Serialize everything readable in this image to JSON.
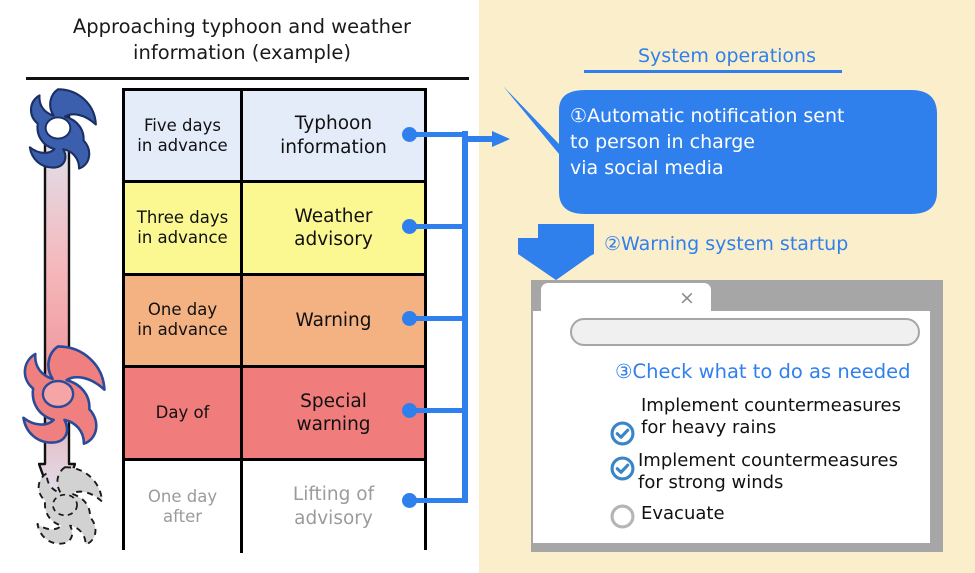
{
  "left_panel": {
    "title": "Approaching typhoon and weather information (example)",
    "title_line1": "Approaching typhoon and weather",
    "title_line2": "information (example)",
    "table": {
      "rows": [
        {
          "timing": "Five days in advance",
          "timing_l1": "Five days",
          "timing_l2": "in advance",
          "info": "Typhoon information",
          "info_l1": "Typhoon",
          "info_l2": "information",
          "color": "#e4ecfa",
          "state": "active"
        },
        {
          "timing": "Three days in advance",
          "timing_l1": "Three days",
          "timing_l2": "in advance",
          "info": "Weather advisory",
          "info_l1": "Weather",
          "info_l2": "advisory",
          "color": "#fbf791",
          "state": "active"
        },
        {
          "timing": "One day in advance",
          "timing_l1": "One day",
          "timing_l2": "in advance",
          "info": "Warning",
          "info_l1": "Warning",
          "info_l2": "",
          "color": "#f4b181",
          "state": "active"
        },
        {
          "timing": "Day of",
          "timing_l1": "Day of",
          "timing_l2": "",
          "info": "Special warning",
          "info_l1": "Special",
          "info_l2": "warning",
          "color": "#f07c7c",
          "state": "active"
        },
        {
          "timing": "One day after",
          "timing_l1": "One day",
          "timing_l2": "after",
          "info": "Lifting of advisory",
          "info_l1": "Lifting of",
          "info_l2": "advisory",
          "color": "#ffffff",
          "state": "dimmed"
        }
      ]
    },
    "timeline": {
      "approaching_cyclone_color": "#3b5fad",
      "peak_cyclone_color": "#f08080",
      "dissipating_cyclone_color": "#d0d0d0"
    }
  },
  "right_panel": {
    "heading": "System operations",
    "accent_color": "#2f80ed",
    "background_color": "#fbeecb",
    "step1": {
      "text": "①Automatic notification sent to person in charge via social media",
      "line1": "①Automatic notification sent",
      "line2": "to person in charge",
      "line3": "via social media"
    },
    "step2": {
      "label": "②Warning system startup"
    },
    "step3": {
      "heading": "③Check what to do as needed",
      "search_value": "",
      "close_label": "×",
      "checklist": [
        {
          "label": "Implement countermeasures for heavy rains",
          "line1": "Implement countermeasures",
          "line2": " for heavy rains",
          "checked": true
        },
        {
          "label": "Implement countermeasures for strong winds",
          "line1": "Implement countermeasures",
          "line2": " for strong winds",
          "checked": true
        },
        {
          "label": "Evacuate",
          "line1": "Evacuate",
          "line2": "",
          "checked": false
        }
      ]
    }
  }
}
